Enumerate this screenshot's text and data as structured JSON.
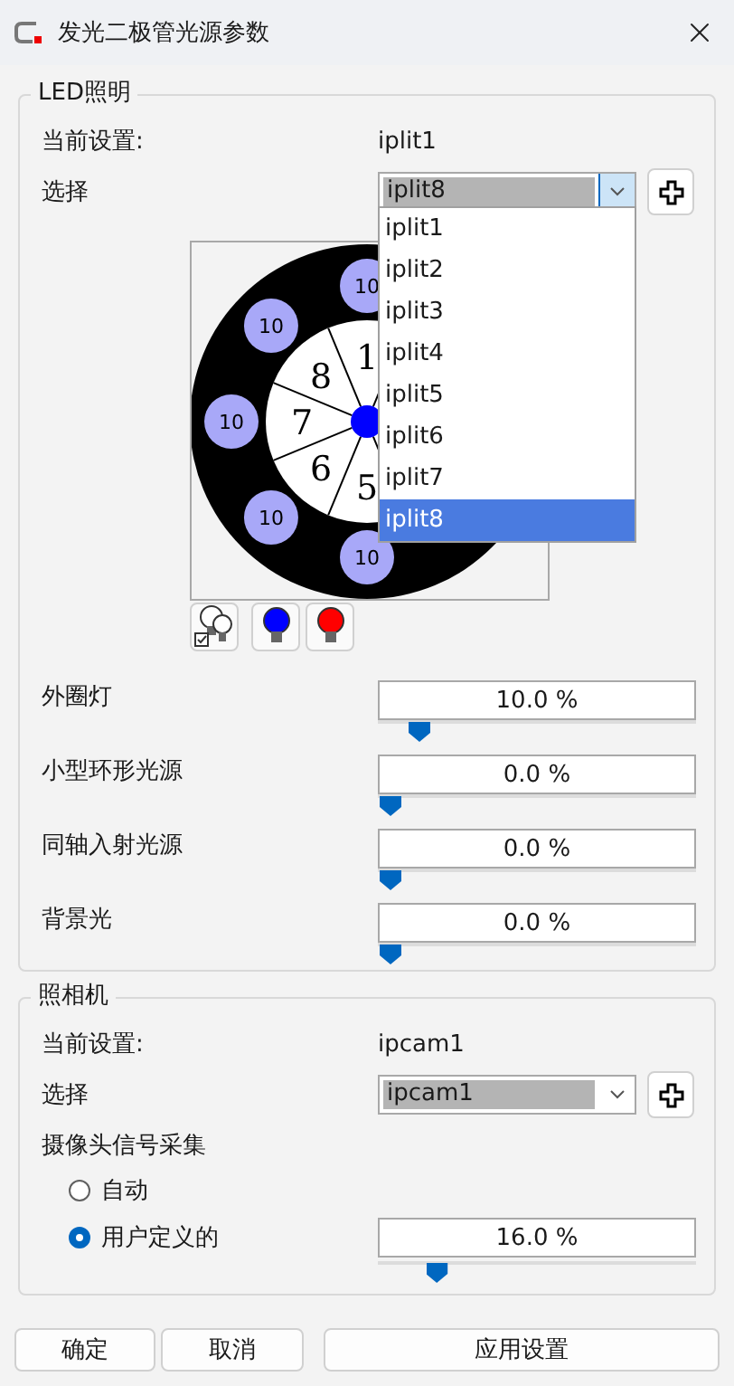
{
  "window": {
    "title": "发光二极管光源参数"
  },
  "led_group": {
    "title": "LED照明",
    "current_label": "当前设置:",
    "current_value": "iplit1",
    "select_label": "选择",
    "select": {
      "value": "iplit8",
      "expanded": true
    },
    "dropdown": [
      {
        "label": "iplit1",
        "selected": false
      },
      {
        "label": "iplit2",
        "selected": false
      },
      {
        "label": "iplit3",
        "selected": false
      },
      {
        "label": "iplit4",
        "selected": false
      },
      {
        "label": "iplit5",
        "selected": false
      },
      {
        "label": "iplit6",
        "selected": false
      },
      {
        "label": "iplit7",
        "selected": false
      },
      {
        "label": "iplit8",
        "selected": true
      }
    ],
    "diagram": {
      "sectors": [
        {
          "label": "8"
        },
        {
          "label": "1"
        },
        {
          "label": "7"
        },
        {
          "label": "6"
        },
        {
          "label": "5"
        }
      ],
      "spots": [
        {
          "label": "10"
        },
        {
          "label": "10"
        },
        {
          "label": "10"
        },
        {
          "label": "10"
        },
        {
          "label": "10"
        }
      ]
    },
    "bulb_buttons": [
      {
        "kind": "multi"
      },
      {
        "kind": "single",
        "color": "#0000ff"
      },
      {
        "kind": "single",
        "color": "#ff0000"
      }
    ],
    "sliders": [
      {
        "label": "外圈灯",
        "reading": "10.0 %",
        "level": 0.1
      },
      {
        "label": "小型环形光源",
        "reading": "0.0 %",
        "level": 0
      },
      {
        "label": "同轴入射光源",
        "reading": "0.0 %",
        "level": 0
      },
      {
        "label": "背景光",
        "reading": "0.0 %",
        "level": 0
      }
    ]
  },
  "camera_group": {
    "title": "照相机",
    "current_label": "当前设置:",
    "current_value": "ipcam1",
    "select_label": "选择",
    "select": {
      "value": "ipcam1",
      "expanded": false
    },
    "acquisition_label": "摄像头信号采集",
    "radios": [
      {
        "label": "自动",
        "selected": false
      },
      {
        "label": "用户定义的",
        "selected": true,
        "reading": "16.0 %",
        "level": 0.16
      }
    ]
  },
  "buttons": [
    "确定",
    "取消",
    "应用设置"
  ]
}
